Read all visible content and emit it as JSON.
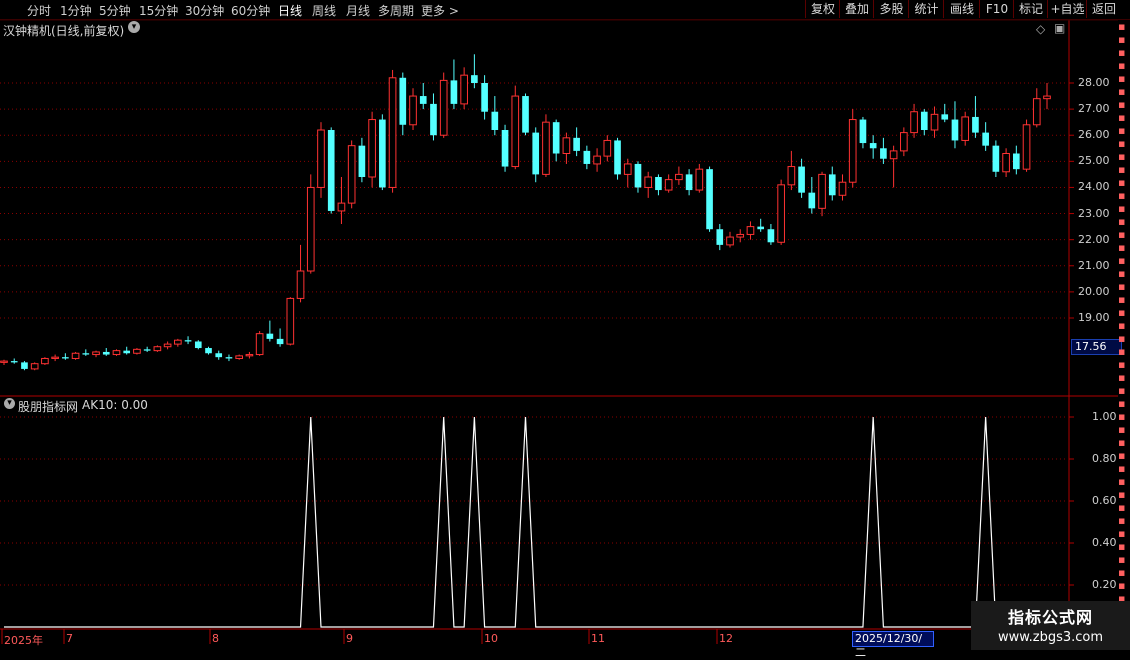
{
  "toolbar": {
    "periods": [
      "分时",
      "1分钟",
      "5分钟",
      "15分钟",
      "30分钟",
      "60分钟",
      "日线",
      "周线",
      "月线",
      "多周期",
      "更多 >"
    ],
    "active_period": "日线",
    "right_buttons": [
      "复权",
      "叠加",
      "多股",
      "统计",
      "画线",
      "F10",
      "标记",
      "+自选",
      "返回"
    ]
  },
  "main_chart": {
    "title": "汉钟精机(日线,前复权)",
    "chevron": "chevron-down-icon",
    "last_price": "17.56",
    "y_ticks": [
      "28.00",
      "27.00",
      "26.00",
      "25.00",
      "24.00",
      "23.00",
      "22.00",
      "21.00",
      "20.00",
      "19.00"
    ]
  },
  "indicator": {
    "title": "股朋指标网",
    "value_text": "AK10: 0.00",
    "y_ticks": [
      "1.00",
      "0.80",
      "0.60",
      "0.40",
      "0.20"
    ]
  },
  "date_axis": {
    "labels": [
      "2025年",
      "7",
      "8",
      "9",
      "10",
      "11",
      "12"
    ],
    "cursor_date": "2025/12/30/二"
  },
  "watermark": {
    "line1": "指标公式网",
    "line2": "www.zbgs3.com"
  },
  "colors": {
    "up": "#ff3232",
    "down": "#54ffff",
    "grid": "#8a0000",
    "axis": "#b00000"
  },
  "chart_data": {
    "type": "candlestick",
    "ylim": [
      16.0,
      29.0
    ],
    "candles": [
      [
        17.3,
        17.4,
        17.2,
        17.35
      ],
      [
        17.35,
        17.45,
        17.25,
        17.3
      ],
      [
        17.3,
        17.35,
        17.0,
        17.05
      ],
      [
        17.05,
        17.3,
        17.0,
        17.25
      ],
      [
        17.25,
        17.5,
        17.2,
        17.45
      ],
      [
        17.45,
        17.6,
        17.35,
        17.5
      ],
      [
        17.5,
        17.65,
        17.4,
        17.45
      ],
      [
        17.45,
        17.7,
        17.4,
        17.65
      ],
      [
        17.65,
        17.8,
        17.55,
        17.6
      ],
      [
        17.6,
        17.75,
        17.5,
        17.7
      ],
      [
        17.7,
        17.85,
        17.55,
        17.6
      ],
      [
        17.6,
        17.8,
        17.55,
        17.75
      ],
      [
        17.75,
        17.9,
        17.6,
        17.65
      ],
      [
        17.65,
        17.85,
        17.6,
        17.8
      ],
      [
        17.8,
        17.9,
        17.7,
        17.75
      ],
      [
        17.75,
        17.95,
        17.7,
        17.9
      ],
      [
        17.9,
        18.1,
        17.8,
        18.0
      ],
      [
        18.0,
        18.2,
        17.9,
        18.15
      ],
      [
        18.15,
        18.3,
        18.0,
        18.1
      ],
      [
        18.1,
        18.15,
        17.8,
        17.85
      ],
      [
        17.85,
        17.9,
        17.6,
        17.65
      ],
      [
        17.65,
        17.75,
        17.4,
        17.5
      ],
      [
        17.5,
        17.6,
        17.35,
        17.45
      ],
      [
        17.45,
        17.6,
        17.4,
        17.55
      ],
      [
        17.55,
        17.7,
        17.45,
        17.6
      ],
      [
        17.6,
        18.5,
        17.55,
        18.4
      ],
      [
        18.4,
        18.9,
        18.1,
        18.2
      ],
      [
        18.2,
        18.6,
        17.9,
        18.0
      ],
      [
        18.0,
        19.8,
        17.95,
        19.75
      ],
      [
        19.75,
        21.8,
        19.6,
        20.8
      ],
      [
        20.8,
        24.5,
        20.7,
        24.0
      ],
      [
        24.0,
        26.5,
        23.6,
        26.2
      ],
      [
        26.2,
        26.3,
        23.0,
        23.1
      ],
      [
        23.1,
        24.4,
        22.6,
        23.4
      ],
      [
        23.4,
        25.8,
        23.2,
        25.6
      ],
      [
        25.6,
        25.9,
        24.2,
        24.4
      ],
      [
        24.4,
        26.9,
        24.0,
        26.6
      ],
      [
        26.6,
        26.8,
        23.9,
        24.0
      ],
      [
        24.0,
        28.5,
        23.8,
        28.2
      ],
      [
        28.2,
        28.4,
        26.0,
        26.4
      ],
      [
        26.4,
        27.8,
        26.2,
        27.5
      ],
      [
        27.5,
        28.0,
        27.0,
        27.2
      ],
      [
        27.2,
        27.6,
        25.8,
        26.0
      ],
      [
        26.0,
        28.4,
        25.9,
        28.1
      ],
      [
        28.1,
        28.9,
        27.0,
        27.2
      ],
      [
        27.2,
        28.6,
        27.0,
        28.3
      ],
      [
        28.3,
        29.1,
        27.8,
        28.0
      ],
      [
        28.0,
        28.3,
        26.6,
        26.9
      ],
      [
        26.9,
        27.5,
        26.0,
        26.2
      ],
      [
        26.2,
        26.4,
        24.6,
        24.8
      ],
      [
        24.8,
        27.9,
        24.7,
        27.5
      ],
      [
        27.5,
        27.6,
        26.0,
        26.1
      ],
      [
        26.1,
        26.3,
        24.2,
        24.5
      ],
      [
        24.5,
        26.8,
        24.4,
        26.5
      ],
      [
        26.5,
        26.6,
        25.0,
        25.3
      ],
      [
        25.3,
        26.1,
        24.9,
        25.9
      ],
      [
        25.9,
        26.3,
        25.2,
        25.4
      ],
      [
        25.4,
        25.6,
        24.7,
        24.9
      ],
      [
        24.9,
        25.5,
        24.6,
        25.2
      ],
      [
        25.2,
        26.0,
        25.0,
        25.8
      ],
      [
        25.8,
        25.9,
        24.3,
        24.5
      ],
      [
        24.5,
        25.1,
        24.0,
        24.9
      ],
      [
        24.9,
        25.0,
        23.8,
        24.0
      ],
      [
        24.0,
        24.6,
        23.6,
        24.4
      ],
      [
        24.4,
        24.5,
        23.7,
        23.9
      ],
      [
        23.9,
        24.5,
        23.8,
        24.3
      ],
      [
        24.3,
        24.8,
        24.1,
        24.5
      ],
      [
        24.5,
        24.7,
        23.7,
        23.9
      ],
      [
        23.9,
        24.9,
        23.8,
        24.7
      ],
      [
        24.7,
        24.8,
        22.3,
        22.4
      ],
      [
        22.4,
        22.6,
        21.6,
        21.8
      ],
      [
        21.8,
        22.3,
        21.7,
        22.1
      ],
      [
        22.1,
        22.4,
        21.9,
        22.2
      ],
      [
        22.2,
        22.7,
        22.0,
        22.5
      ],
      [
        22.5,
        22.8,
        22.3,
        22.4
      ],
      [
        22.4,
        22.6,
        21.8,
        21.9
      ],
      [
        21.9,
        24.3,
        21.8,
        24.1
      ],
      [
        24.1,
        25.4,
        23.9,
        24.8
      ],
      [
        24.8,
        25.1,
        23.6,
        23.8
      ],
      [
        23.8,
        24.4,
        23.0,
        23.2
      ],
      [
        23.2,
        24.6,
        22.9,
        24.5
      ],
      [
        24.5,
        24.8,
        23.5,
        23.7
      ],
      [
        23.7,
        24.5,
        23.5,
        24.2
      ],
      [
        24.2,
        27.0,
        24.0,
        26.6
      ],
      [
        26.6,
        26.7,
        25.5,
        25.7
      ],
      [
        25.7,
        26.0,
        25.1,
        25.5
      ],
      [
        25.5,
        25.9,
        24.9,
        25.1
      ],
      [
        25.1,
        25.6,
        24.0,
        25.4
      ],
      [
        25.4,
        26.3,
        25.2,
        26.1
      ],
      [
        26.1,
        27.2,
        25.9,
        26.9
      ],
      [
        26.9,
        27.0,
        26.0,
        26.2
      ],
      [
        26.2,
        27.1,
        25.9,
        26.8
      ],
      [
        26.8,
        27.2,
        26.5,
        26.6
      ],
      [
        26.6,
        27.3,
        25.5,
        25.8
      ],
      [
        25.8,
        26.9,
        25.6,
        26.7
      ],
      [
        26.7,
        27.5,
        25.9,
        26.1
      ],
      [
        26.1,
        26.5,
        25.4,
        25.6
      ],
      [
        25.6,
        25.8,
        24.4,
        24.6
      ],
      [
        24.6,
        25.5,
        24.4,
        25.3
      ],
      [
        25.3,
        25.6,
        24.5,
        24.7
      ],
      [
        24.7,
        26.6,
        24.6,
        26.4
      ],
      [
        26.4,
        27.8,
        26.3,
        27.4
      ],
      [
        27.4,
        28.0,
        27.0,
        27.5
      ]
    ],
    "indicator_series": {
      "name": "AK10",
      "ylim": [
        0,
        1.1
      ],
      "spikes_at_index": [
        30,
        43,
        46,
        51,
        85,
        96
      ],
      "values": "0 everywhere except 1.00 at spikes_at_index"
    }
  }
}
